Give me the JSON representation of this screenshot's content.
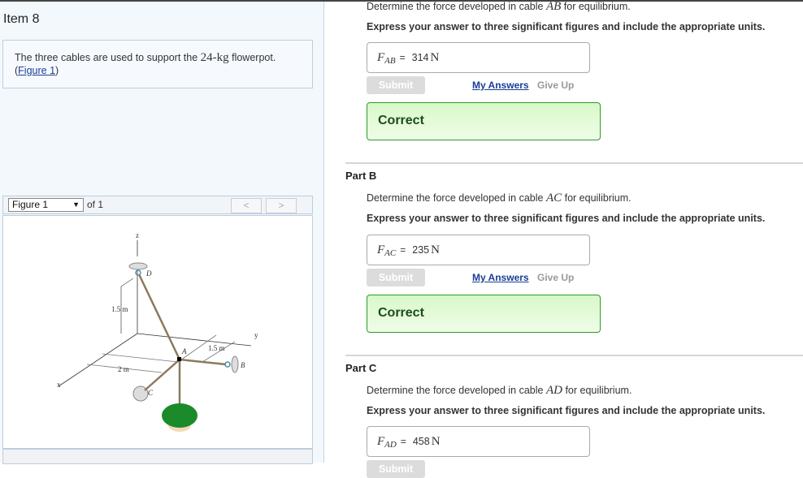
{
  "item": {
    "title": "Item 8",
    "intro_pre": "The three cables are used to support the ",
    "intro_math": "24-kg",
    "intro_post": " flowerpot.",
    "figure_link": "Figure 1"
  },
  "figure": {
    "selector": "Figure 1",
    "of": "of 1",
    "prev": "<",
    "next": ">",
    "labels": {
      "z": "z",
      "y": "y",
      "x": "x",
      "D": "D",
      "A": "A",
      "B": "B",
      "C": "C",
      "h": "1.5 m",
      "w": "1.5 m",
      "l": "2 m"
    }
  },
  "parts": [
    {
      "name": "",
      "question_pre": "Determine the force developed in cable ",
      "cable": "AB",
      "question_post": " for equilibrium.",
      "express": "Express your answer to three significant figures and include the appropriate units.",
      "var": "F",
      "sub": "AB",
      "eq": "=",
      "value": "314",
      "unit": "N",
      "submit": "Submit",
      "my_answers": "My Answers",
      "give_up": "Give Up",
      "result": "Correct"
    },
    {
      "name": "Part B",
      "question_pre": "Determine the force developed in cable ",
      "cable": "AC",
      "question_post": " for equilibrium.",
      "express": "Express your answer to three significant figures and include the appropriate units.",
      "var": "F",
      "sub": "AC",
      "eq": "=",
      "value": "235",
      "unit": "N",
      "submit": "Submit",
      "my_answers": "My Answers",
      "give_up": "Give Up",
      "result": "Correct"
    },
    {
      "name": "Part C",
      "question_pre": "Determine the force developed in cable ",
      "cable": "AD",
      "question_post": " for equilibrium.",
      "express": "Express your answer to three significant figures and include the appropriate units.",
      "var": "F",
      "sub": "AD",
      "eq": "=",
      "value": "458",
      "unit": "N",
      "submit": "Submit"
    }
  ],
  "colors": {
    "correct_border": "#2a9b2a",
    "correct_bg": "#d8f8c8",
    "link": "#1a3d96"
  }
}
